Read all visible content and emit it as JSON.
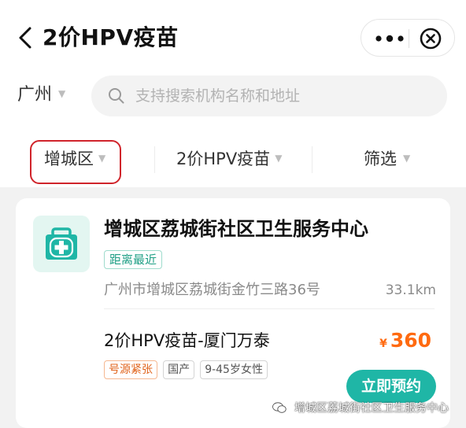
{
  "header": {
    "title": "2价HPV疫苗",
    "icons": {
      "back": "back-chevron-icon",
      "more": "more-dots-icon",
      "close": "close-circle-icon"
    }
  },
  "search": {
    "city": "广州",
    "placeholder": "支持搜索机构名称和地址"
  },
  "filters": {
    "district": "增城区",
    "vaccine": "2价HPV疫苗",
    "screen": "筛选"
  },
  "card": {
    "name": "增城区荔城街社区卫生服务中心",
    "near_tag": "距离最近",
    "address": "广州市增城区荔城街金竹三路36号",
    "distance": "33.1km",
    "vaccine_name": "2价HPV疫苗-厦门万泰",
    "currency": "¥",
    "price": "360",
    "tags": [
      "号源紧张",
      "国产",
      "9-45岁女性"
    ],
    "book_label": "立即预约"
  },
  "watermark": {
    "text": "增城区荔城街社区卫生服务中心"
  },
  "colors": {
    "accent": "#1fb6a6",
    "price": "#ff6a10",
    "highlight_box": "#d0242b"
  }
}
